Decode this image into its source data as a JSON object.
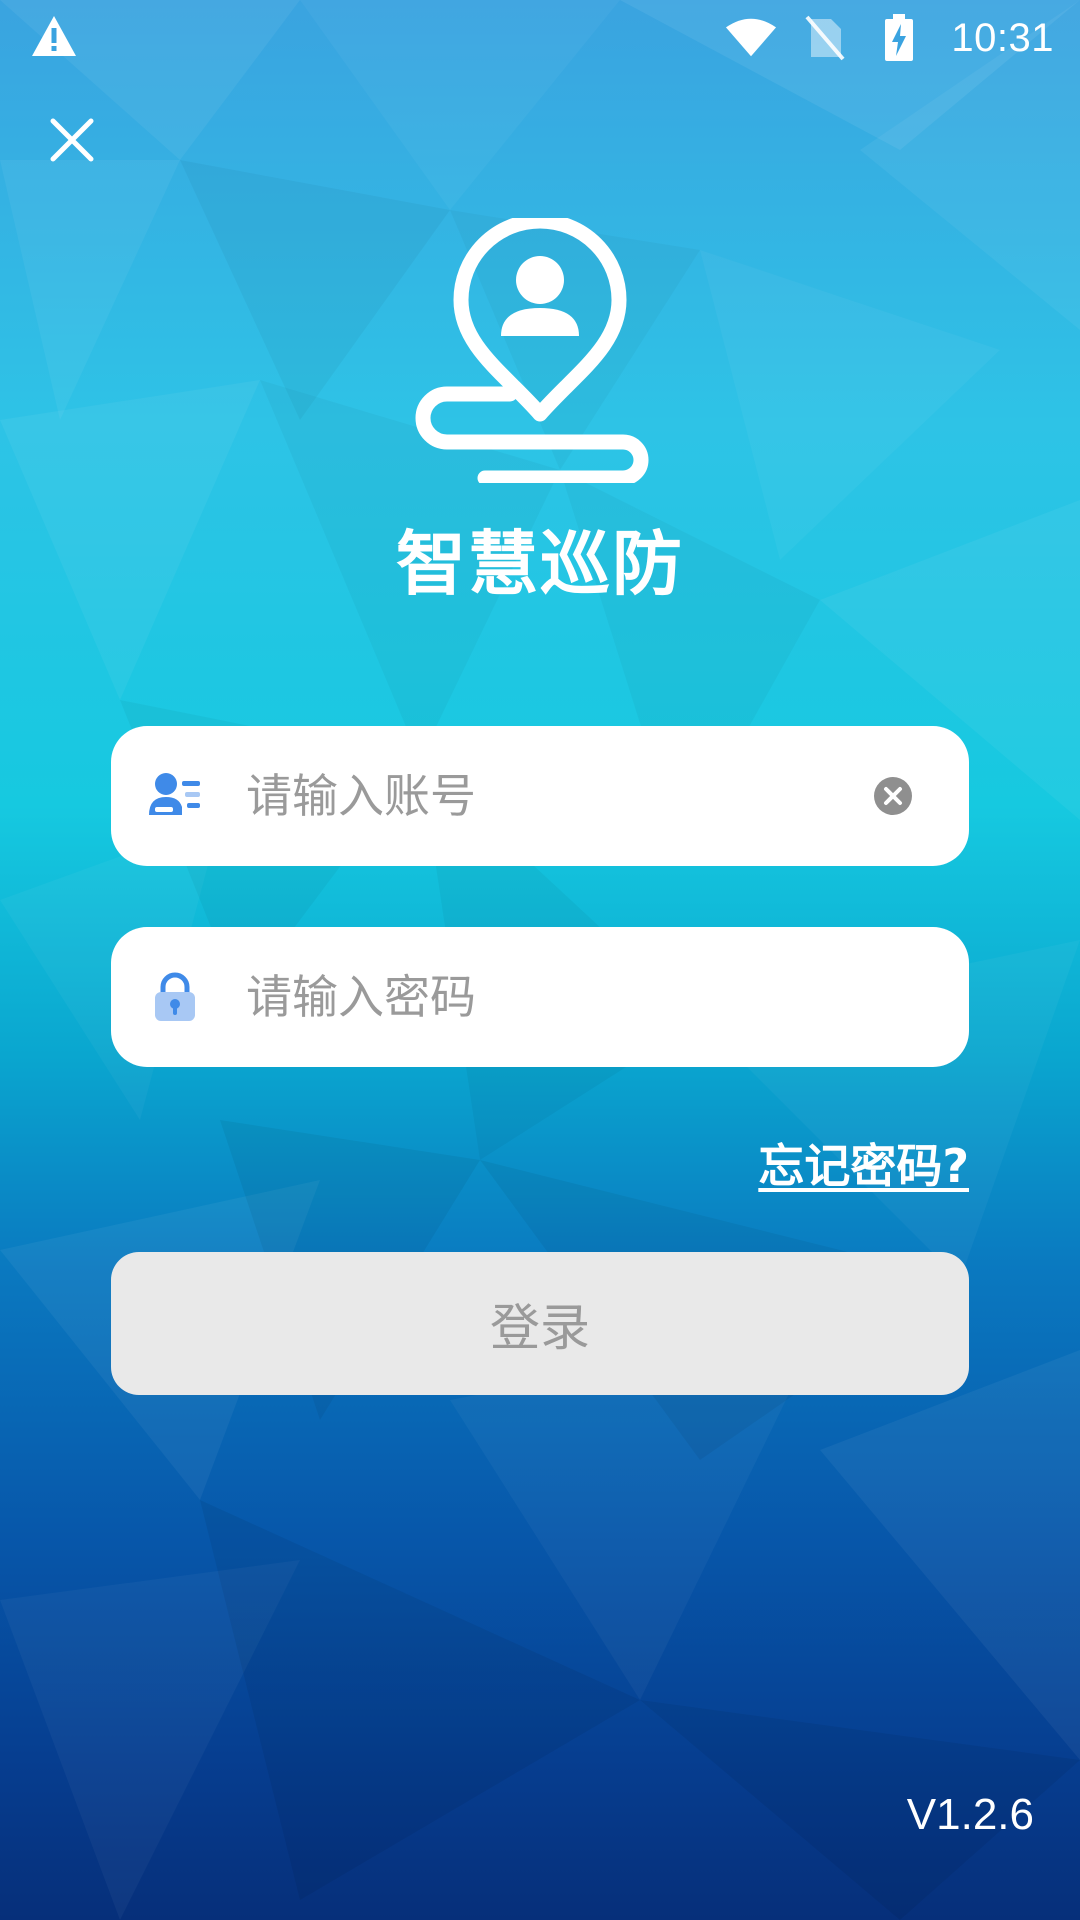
{
  "status_bar": {
    "time": "10:31",
    "icons": [
      "warning-icon",
      "wifi-icon",
      "no-sim-icon",
      "battery-charging-icon"
    ]
  },
  "app": {
    "title": "智慧巡防",
    "version": "V1.2.6"
  },
  "login_form": {
    "account_placeholder": "请输入账号",
    "account_value": "",
    "password_placeholder": "请输入密码",
    "password_value": "",
    "forgot_label": "忘记密码?",
    "login_label": "登录"
  },
  "colors": {
    "login_button_bg": "#e9e9e9",
    "login_button_text": "#9a9a9a",
    "field_icon_blue": "#3f8ae8",
    "field_icon_light": "#a8c8f4"
  }
}
